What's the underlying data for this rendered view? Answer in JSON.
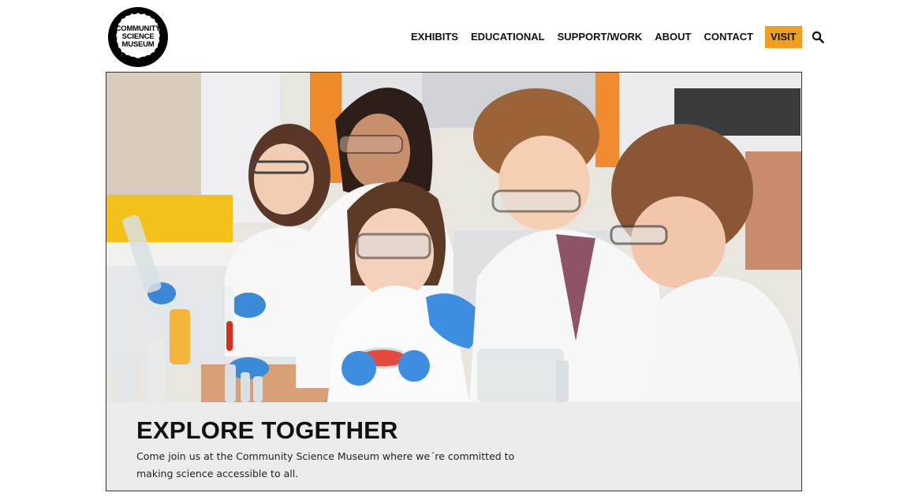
{
  "brand": {
    "logo_lines": [
      "COMMUNITY",
      "SCIENCE",
      "MUSEUM"
    ]
  },
  "nav": {
    "items": [
      "EXHIBITS",
      "EDUCATIONAL",
      "SUPPORT/WORK",
      "ABOUT",
      "CONTACT"
    ],
    "visit_label": "VISIT",
    "search_icon": "search-icon"
  },
  "hero": {
    "title": "EXPLORE TOGETHER",
    "text": "Come join us at the Community Science Museum where we´re committed to making science accessible to all."
  },
  "colors": {
    "visit_accent": "#f0a01e",
    "caption_bg": "#ebebeb"
  }
}
